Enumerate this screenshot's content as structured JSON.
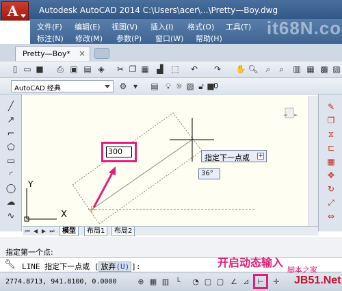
{
  "window": {
    "title": "Autodesk AutoCAD 2014    C:\\Users\\acer\\...\\Pretty—Boy.dwg",
    "watermark": "it68N.com"
  },
  "menus": [
    {
      "label": "文件(F)"
    },
    {
      "label": "编辑(E)"
    },
    {
      "label": "视图(V)"
    },
    {
      "label": "插入(I)"
    },
    {
      "label": "格式(O)"
    },
    {
      "label": "工具(T)"
    },
    {
      "label": "标注(N)"
    },
    {
      "label": "修改(M)"
    },
    {
      "label": "参数(P)"
    },
    {
      "label": "窗口(W)"
    },
    {
      "label": "帮助(H)"
    }
  ],
  "tabs": {
    "document": "Pretty—Boy*",
    "close": "×"
  },
  "toolbar2": {
    "workspace": "AutoCAD 经典",
    "layer_value": "0"
  },
  "drawing": {
    "dynamic_input_value": "300",
    "tooltip": "指定下一点或",
    "tooltip_plus": "+",
    "angle": "36°",
    "ucs_y": "Y",
    "ucs_x": "X"
  },
  "layout_tabs": {
    "model": "模型",
    "layout1": "布局1",
    "layout2": "布局2"
  },
  "command": {
    "history_line": "指定第一个点:",
    "prompt_prefix": "LINE 指定下一点或 [",
    "prompt_option": "放弃",
    "prompt_key": "(U)",
    "prompt_suffix": "]:"
  },
  "statusbar": {
    "coords": "2774.8713, 941.8100, 0.0000"
  },
  "annotations": {
    "caption": "开启动态输入",
    "site1": "脚本之家",
    "site2": "JB51.Net"
  },
  "colors": {
    "highlight": "#e0207a",
    "titlebar": "#3d6290",
    "canvas": "#fffef2"
  }
}
